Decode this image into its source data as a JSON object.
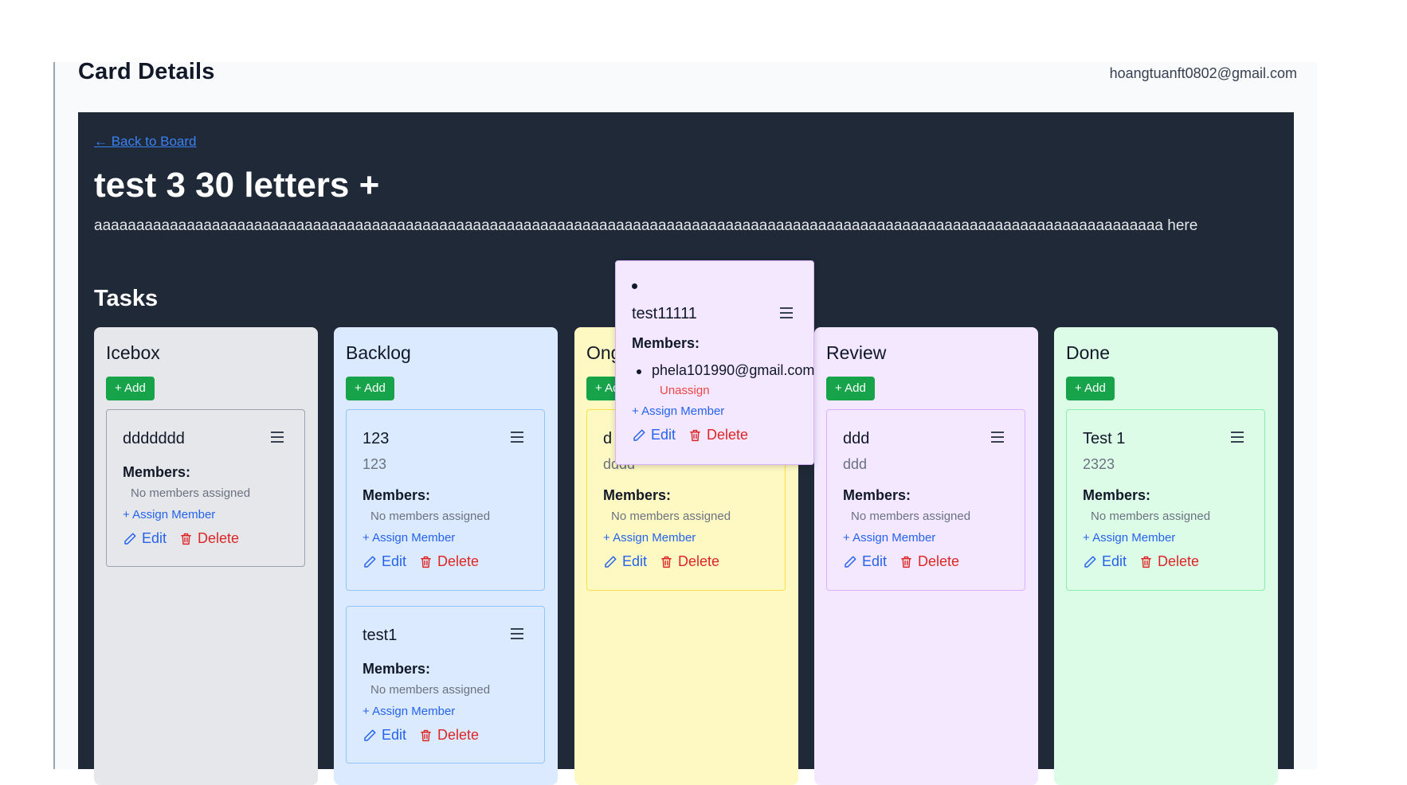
{
  "header": {
    "page_title": "Card Details",
    "user_email": "hoangtuanft0802@gmail.com"
  },
  "board": {
    "back_link": "← Back to Board",
    "card_title": "test 3 30 letters +",
    "card_description": "aaaaaaaaaaaaaaaaaaaaaaaaaaaaaaaaaaaaaaaaaaaaaaaaaaaaaaaaaaaaaaaaaaaaaaaaaaaaaaaaaaaaaaaaaaaaaaaaaaaaaaaaaaaaaaaaaaaaaaaaaaaaaaa here",
    "tasks_heading": "Tasks"
  },
  "labels": {
    "add": "+ Add",
    "members": "Members:",
    "no_members": "No members assigned",
    "assign_member": "+ Assign Member",
    "edit": "Edit",
    "delete": "Delete",
    "unassign": "Unassign"
  },
  "columns": [
    {
      "title": "Icebox",
      "cards": [
        {
          "name": "ddddddd",
          "description": ""
        }
      ]
    },
    {
      "title": "Backlog",
      "cards": [
        {
          "name": "123",
          "description": "123"
        },
        {
          "name": "test1",
          "description": ""
        }
      ]
    },
    {
      "title": "Ong",
      "cards": [
        {
          "name": "d",
          "description": "dddd"
        }
      ]
    },
    {
      "title": "Review",
      "cards": [
        {
          "name": "ddd",
          "description": "ddd"
        }
      ]
    },
    {
      "title": "Done",
      "cards": [
        {
          "name": "Test 1",
          "description": "2323"
        }
      ]
    }
  ],
  "dragged_card": {
    "name": "test11111",
    "members": [
      "phela101990@gmail.com"
    ]
  },
  "colors": {
    "board_bg": "#1f2937",
    "icebox": "#e5e7eb",
    "backlog": "#dbeafe",
    "ongoing": "#fef9c3",
    "review": "#f3e8ff",
    "done": "#dcfce7",
    "add_button": "#16a34a",
    "link_blue": "#2563eb",
    "delete_red": "#dc2626"
  }
}
